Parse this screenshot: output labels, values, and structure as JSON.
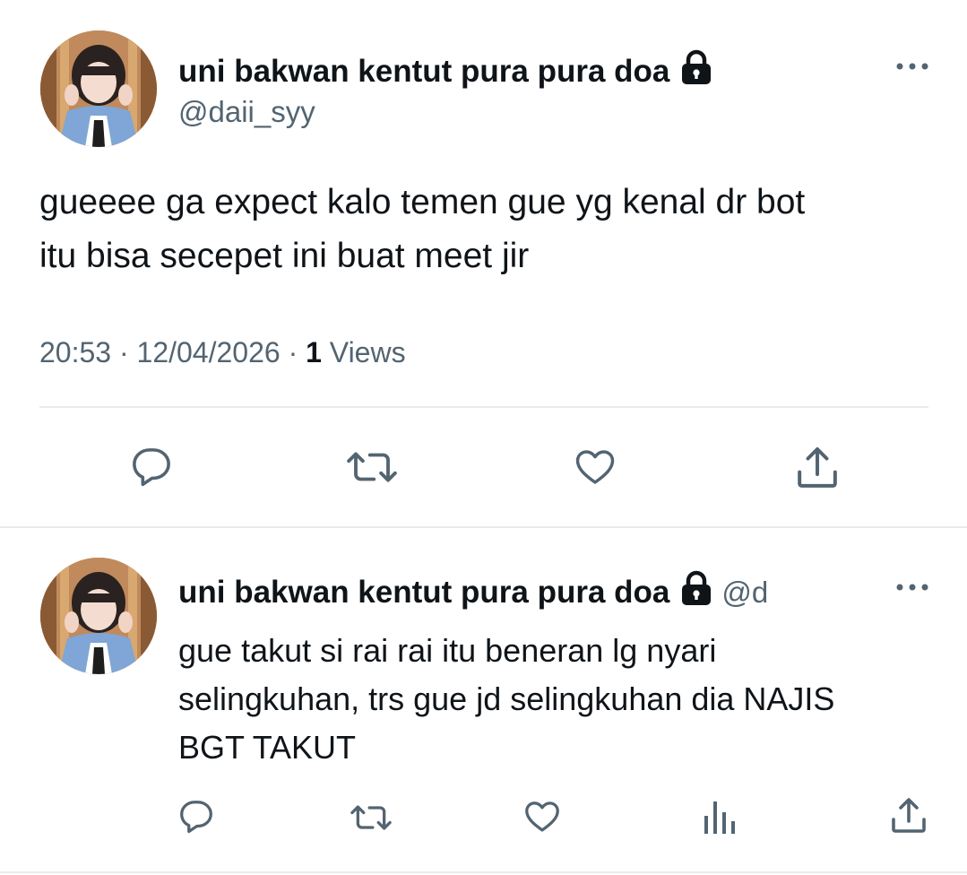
{
  "main_tweet": {
    "display_name": "uni bakwan kentut pura pura doa",
    "handle": "@daii_syy",
    "text_line1": "gueeee ga expect kalo temen gue yg kenal dr bot",
    "text_line2": "itu bisa secepet ini buat meet jir",
    "time": "20:53",
    "separator": "·",
    "date": "12/04/2026",
    "views_count": "1",
    "views_label": "Views",
    "actions": [
      "reply-icon",
      "retweet-icon",
      "like-icon",
      "share-icon"
    ]
  },
  "reply_tweet": {
    "display_name": "uni bakwan kentut pura pura doa",
    "handle_truncated": "@d",
    "text_line1": "gue takut si rai rai itu beneran lg nyari",
    "text_line2": "selingkuhan, trs gue jd selingkuhan dia NAJIS",
    "text_line3": "BGT TAKUT",
    "actions": [
      "reply-icon",
      "retweet-icon",
      "like-icon",
      "analytics-icon",
      "share-icon"
    ]
  },
  "colors": {
    "text": "#0f1419",
    "secondary": "#536471",
    "divider": "#e7ebee"
  },
  "more_icon": "more-horizontal-icon",
  "lock_icon": "lock-icon"
}
